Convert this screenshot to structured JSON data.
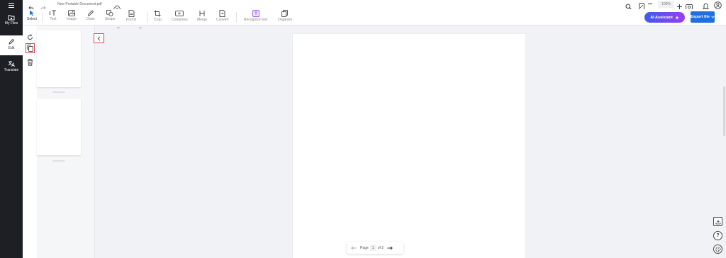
{
  "window": {
    "document_title": "New Portable Document.pdf"
  },
  "rail": {
    "items": [
      {
        "label": "My Files",
        "icon": "folder-icon"
      },
      {
        "label": "Edit",
        "icon": "pencil-icon"
      },
      {
        "label": "Translate",
        "icon": "translate-icon"
      }
    ]
  },
  "toolbar": {
    "select": "Select",
    "text": "Text",
    "image": "Image",
    "draw": "Draw",
    "shape": "Shape",
    "forms": "Forms",
    "crop": "Crop",
    "compress": "Compress",
    "merge": "Merge",
    "convert": "Convert",
    "recognize": "Recognize text",
    "organize": "Organize"
  },
  "topright": {
    "zoom": "100%",
    "ai_label": "AI Assistant",
    "export_label": "Export file"
  },
  "pager": {
    "label": "Page",
    "current": "1",
    "of_label": "of 2"
  },
  "colors": {
    "accent_blue": "#1f6fe0",
    "ai_gradient_start": "#3e5cf0",
    "ai_gradient_end": "#9b3cf0",
    "highlight_red": "#d64550",
    "rail_bg": "#1e1f24"
  }
}
